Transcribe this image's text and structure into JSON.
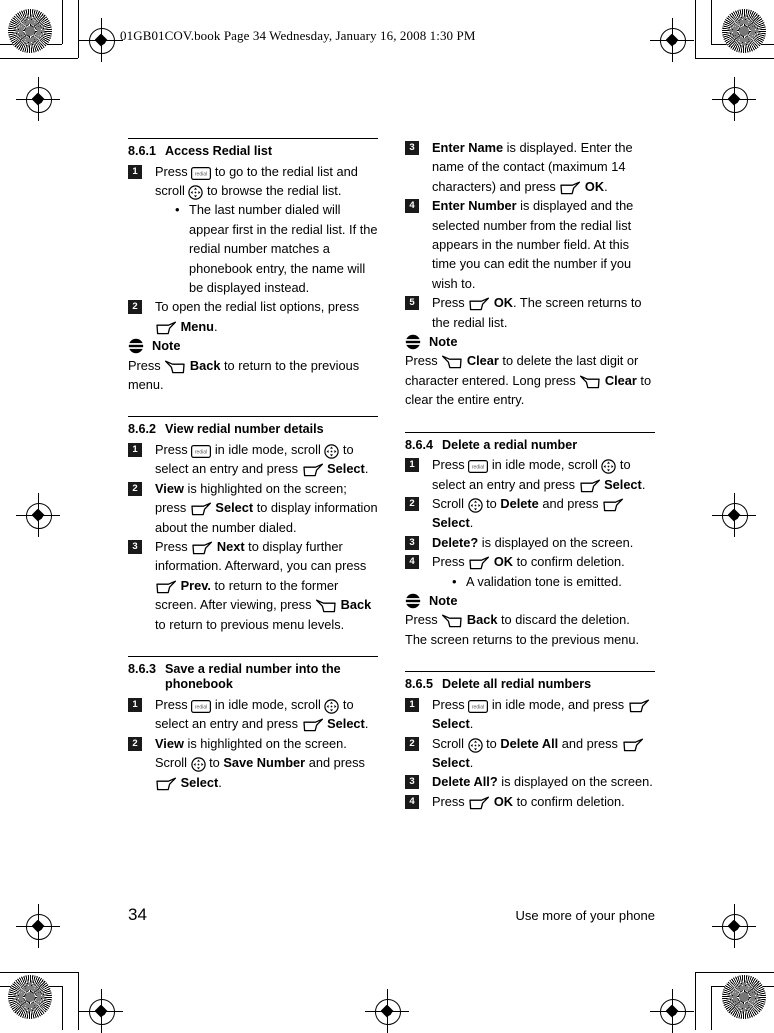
{
  "header_slug": "01GB01COV.book  Page 34  Wednesday, January 16, 2008  1:30 PM",
  "footer": {
    "page_number": "34",
    "running_head": "Use more of your phone"
  },
  "icons": {
    "redial": "redial-key-icon",
    "redial_label": "redial",
    "navigation": "navigation-scroll-icon",
    "softkey_left": "left-softkey-icon",
    "softkey_right": "right-softkey-icon",
    "note": "note-icon"
  },
  "note_label": "Note",
  "sections": [
    {
      "id": "8.6.1",
      "number": "8.6.1",
      "title": "Access Redial list",
      "column": "left",
      "steps": [
        {
          "badge": "1",
          "parts": [
            {
              "t": "text",
              "v": "Press "
            },
            {
              "t": "icon",
              "v": "redial"
            },
            {
              "t": "text",
              "v": " to go to the redial list and scroll "
            },
            {
              "t": "icon",
              "v": "nav"
            },
            {
              "t": "text",
              "v": " to browse the redial list."
            }
          ],
          "bullets": [
            "The last number dialed will appear first in the redial list. If the redial number matches a phonebook entry, the name will be displayed instead."
          ]
        },
        {
          "badge": "2",
          "parts": [
            {
              "t": "text",
              "v": "To open the redial list options, press "
            },
            {
              "t": "icon",
              "v": "sk-left"
            },
            {
              "t": "text",
              "v": " "
            },
            {
              "t": "bold",
              "v": "Menu"
            },
            {
              "t": "text",
              "v": "."
            }
          ]
        }
      ],
      "note": {
        "parts": [
          {
            "t": "text",
            "v": "Press "
          },
          {
            "t": "icon",
            "v": "sk-right"
          },
          {
            "t": "text",
            "v": " "
          },
          {
            "t": "bold",
            "v": "Back"
          },
          {
            "t": "text",
            "v": " to return to the previous menu."
          }
        ]
      }
    },
    {
      "id": "8.6.2",
      "number": "8.6.2",
      "title": "View redial number details",
      "column": "left",
      "steps": [
        {
          "badge": "1",
          "parts": [
            {
              "t": "text",
              "v": "Press "
            },
            {
              "t": "icon",
              "v": "redial"
            },
            {
              "t": "text",
              "v": " in idle mode, scroll "
            },
            {
              "t": "icon",
              "v": "nav"
            },
            {
              "t": "text",
              "v": " to select an entry and press "
            },
            {
              "t": "icon",
              "v": "sk-left"
            },
            {
              "t": "text",
              "v": " "
            },
            {
              "t": "bold",
              "v": "Select"
            },
            {
              "t": "text",
              "v": "."
            }
          ]
        },
        {
          "badge": "2",
          "parts": [
            {
              "t": "bold",
              "v": "View"
            },
            {
              "t": "text",
              "v": " is highlighted on the screen; press "
            },
            {
              "t": "icon",
              "v": "sk-left"
            },
            {
              "t": "text",
              "v": " "
            },
            {
              "t": "bold",
              "v": "Select"
            },
            {
              "t": "text",
              "v": " to display information about the number dialed."
            }
          ]
        },
        {
          "badge": "3",
          "parts": [
            {
              "t": "text",
              "v": "Press "
            },
            {
              "t": "icon",
              "v": "sk-left"
            },
            {
              "t": "text",
              "v": " "
            },
            {
              "t": "bold",
              "v": "Next"
            },
            {
              "t": "text",
              "v": " to display further information. Afterward, you can press "
            },
            {
              "t": "icon",
              "v": "sk-left"
            },
            {
              "t": "text",
              "v": " "
            },
            {
              "t": "bold",
              "v": "Prev."
            },
            {
              "t": "text",
              "v": " to return to the former screen. After viewing, press "
            },
            {
              "t": "icon",
              "v": "sk-right"
            },
            {
              "t": "text",
              "v": " "
            },
            {
              "t": "bold",
              "v": "Back"
            },
            {
              "t": "text",
              "v": " to return to previous menu levels."
            }
          ]
        }
      ]
    },
    {
      "id": "8.6.3",
      "number": "8.6.3",
      "title": "Save a redial number into the phonebook",
      "column": "left",
      "steps": [
        {
          "badge": "1",
          "parts": [
            {
              "t": "text",
              "v": "Press "
            },
            {
              "t": "icon",
              "v": "redial"
            },
            {
              "t": "text",
              "v": " in idle mode, scroll "
            },
            {
              "t": "icon",
              "v": "nav"
            },
            {
              "t": "text",
              "v": " to select an entry and press "
            },
            {
              "t": "icon",
              "v": "sk-left"
            },
            {
              "t": "text",
              "v": " "
            },
            {
              "t": "bold",
              "v": "Select"
            },
            {
              "t": "text",
              "v": "."
            }
          ]
        },
        {
          "badge": "2",
          "parts": [
            {
              "t": "bold",
              "v": "View"
            },
            {
              "t": "text",
              "v": " is highlighted on the screen. Scroll "
            },
            {
              "t": "icon",
              "v": "nav"
            },
            {
              "t": "text",
              "v": " to "
            },
            {
              "t": "bold",
              "v": "Save Number"
            },
            {
              "t": "text",
              "v": " and press "
            },
            {
              "t": "icon",
              "v": "sk-left"
            },
            {
              "t": "text",
              "v": " "
            },
            {
              "t": "bold",
              "v": "Select"
            },
            {
              "t": "text",
              "v": "."
            }
          ]
        }
      ]
    },
    {
      "id": "8.6.3-cont",
      "number": "",
      "title": "",
      "column": "right",
      "steps": [
        {
          "badge": "3",
          "parts": [
            {
              "t": "bold",
              "v": "Enter Name"
            },
            {
              "t": "text",
              "v": " is displayed. Enter the name of the contact (maximum 14 characters) and press "
            },
            {
              "t": "icon",
              "v": "sk-left"
            },
            {
              "t": "text",
              "v": " "
            },
            {
              "t": "bold",
              "v": "OK"
            },
            {
              "t": "text",
              "v": "."
            }
          ]
        },
        {
          "badge": "4",
          "parts": [
            {
              "t": "bold",
              "v": "Enter Number"
            },
            {
              "t": "text",
              "v": " is displayed and the selected number from the redial list appears in the number field. At this time you can edit the number if you wish to."
            }
          ]
        },
        {
          "badge": "5",
          "parts": [
            {
              "t": "text",
              "v": "Press "
            },
            {
              "t": "icon",
              "v": "sk-left"
            },
            {
              "t": "text",
              "v": " "
            },
            {
              "t": "bold",
              "v": "OK"
            },
            {
              "t": "text",
              "v": ". The screen returns to the redial list."
            }
          ]
        }
      ],
      "note": {
        "parts": [
          {
            "t": "text",
            "v": "Press "
          },
          {
            "t": "icon",
            "v": "sk-right"
          },
          {
            "t": "text",
            "v": " "
          },
          {
            "t": "bold",
            "v": "Clear"
          },
          {
            "t": "text",
            "v": " to delete the last digit or character entered. Long press "
          },
          {
            "t": "icon",
            "v": "sk-right"
          },
          {
            "t": "text",
            "v": " "
          },
          {
            "t": "bold",
            "v": "Clear"
          },
          {
            "t": "text",
            "v": " to clear the entire entry."
          }
        ]
      }
    },
    {
      "id": "8.6.4",
      "number": "8.6.4",
      "title": "Delete a redial number",
      "column": "right",
      "steps": [
        {
          "badge": "1",
          "parts": [
            {
              "t": "text",
              "v": "Press "
            },
            {
              "t": "icon",
              "v": "redial"
            },
            {
              "t": "text",
              "v": " in idle mode, scroll "
            },
            {
              "t": "icon",
              "v": "nav"
            },
            {
              "t": "text",
              "v": " to select an entry and press "
            },
            {
              "t": "icon",
              "v": "sk-left"
            },
            {
              "t": "text",
              "v": " "
            },
            {
              "t": "bold",
              "v": "Select"
            },
            {
              "t": "text",
              "v": "."
            }
          ]
        },
        {
          "badge": "2",
          "parts": [
            {
              "t": "text",
              "v": "Scroll "
            },
            {
              "t": "icon",
              "v": "nav"
            },
            {
              "t": "text",
              "v": " to "
            },
            {
              "t": "bold",
              "v": "Delete"
            },
            {
              "t": "text",
              "v": " and press "
            },
            {
              "t": "icon",
              "v": "sk-left"
            },
            {
              "t": "text",
              "v": " "
            },
            {
              "t": "bold",
              "v": "Select"
            },
            {
              "t": "text",
              "v": "."
            }
          ]
        },
        {
          "badge": "3",
          "parts": [
            {
              "t": "bold",
              "v": "Delete?"
            },
            {
              "t": "text",
              "v": " is displayed on the screen."
            }
          ]
        },
        {
          "badge": "4",
          "parts": [
            {
              "t": "text",
              "v": "Press "
            },
            {
              "t": "icon",
              "v": "sk-left"
            },
            {
              "t": "text",
              "v": " "
            },
            {
              "t": "bold",
              "v": "OK"
            },
            {
              "t": "text",
              "v": " to confirm deletion."
            }
          ],
          "bullets": [
            "A validation tone is emitted."
          ]
        }
      ],
      "note": {
        "parts": [
          {
            "t": "text",
            "v": "Press "
          },
          {
            "t": "icon",
            "v": "sk-right"
          },
          {
            "t": "text",
            "v": " "
          },
          {
            "t": "bold",
            "v": "Back"
          },
          {
            "t": "text",
            "v": " to discard the deletion. The screen returns to the previous menu."
          }
        ]
      }
    },
    {
      "id": "8.6.5",
      "number": "8.6.5",
      "title": "Delete all redial numbers",
      "column": "right",
      "steps": [
        {
          "badge": "1",
          "parts": [
            {
              "t": "text",
              "v": "Press "
            },
            {
              "t": "icon",
              "v": "redial"
            },
            {
              "t": "text",
              "v": " in idle mode, and press "
            },
            {
              "t": "icon",
              "v": "sk-left"
            },
            {
              "t": "text",
              "v": " "
            },
            {
              "t": "bold",
              "v": "Select"
            },
            {
              "t": "text",
              "v": "."
            }
          ]
        },
        {
          "badge": "2",
          "parts": [
            {
              "t": "text",
              "v": "Scroll "
            },
            {
              "t": "icon",
              "v": "nav"
            },
            {
              "t": "text",
              "v": " to "
            },
            {
              "t": "bold",
              "v": "Delete All"
            },
            {
              "t": "text",
              "v": " and press "
            },
            {
              "t": "icon",
              "v": "sk-left"
            },
            {
              "t": "text",
              "v": " "
            },
            {
              "t": "bold",
              "v": "Select"
            },
            {
              "t": "text",
              "v": "."
            }
          ]
        },
        {
          "badge": "3",
          "parts": [
            {
              "t": "bold",
              "v": "Delete All?"
            },
            {
              "t": "text",
              "v": " is displayed on the screen."
            }
          ]
        },
        {
          "badge": "4",
          "parts": [
            {
              "t": "text",
              "v": "Press "
            },
            {
              "t": "icon",
              "v": "sk-left"
            },
            {
              "t": "text",
              "v": " "
            },
            {
              "t": "bold",
              "v": "OK"
            },
            {
              "t": "text",
              "v": " to confirm deletion."
            }
          ]
        }
      ]
    }
  ]
}
